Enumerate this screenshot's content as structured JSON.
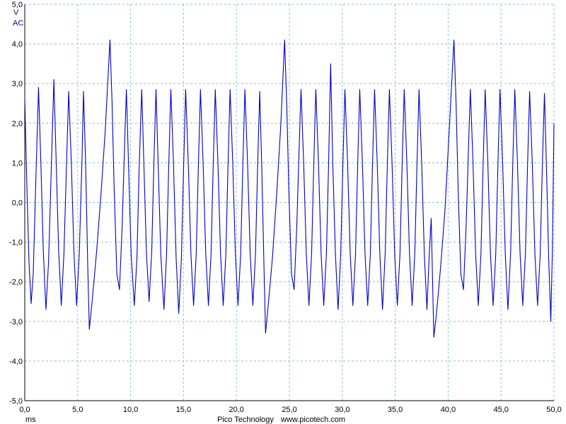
{
  "chart_data": {
    "type": "line",
    "xlabel": "ms",
    "ylabel_unit": "V",
    "ylabel_coupling": "AC",
    "xlim": [
      0,
      50
    ],
    "ylim": [
      -5,
      5
    ],
    "x_ticks": [
      "0,0",
      "5,0",
      "10,0",
      "15,0",
      "20,0",
      "25,0",
      "30,0",
      "35,0",
      "40,0",
      "45,0",
      "50,0"
    ],
    "y_ticks": [
      "5,0",
      "4,0",
      "3,0",
      "2,0",
      "1,0",
      "0,0",
      "-1,0",
      "-2,0",
      "-3,0",
      "-4,0",
      "-5,0"
    ],
    "grid": true,
    "series": [
      {
        "color": "#0000c8",
        "points": [
          [
            0.0,
            2.6
          ],
          [
            0.2,
            0.4
          ],
          [
            0.4,
            -1.5
          ],
          [
            0.6,
            -2.55
          ],
          [
            0.8,
            -1.8
          ],
          [
            1.05,
            0.6
          ],
          [
            1.3,
            2.9
          ],
          [
            1.5,
            1.2
          ],
          [
            1.75,
            -1.2
          ],
          [
            2.0,
            -2.7
          ],
          [
            2.25,
            -1.5
          ],
          [
            2.5,
            0.8
          ],
          [
            2.75,
            3.1
          ],
          [
            2.95,
            1.2
          ],
          [
            3.2,
            -1.2
          ],
          [
            3.45,
            -2.6
          ],
          [
            3.7,
            -1.3
          ],
          [
            3.95,
            1.0
          ],
          [
            4.15,
            2.8
          ],
          [
            4.4,
            1.0
          ],
          [
            4.65,
            -1.3
          ],
          [
            4.9,
            -2.6
          ],
          [
            5.15,
            -1.3
          ],
          [
            5.4,
            1.0
          ],
          [
            5.55,
            2.8
          ],
          [
            5.75,
            1.0
          ],
          [
            5.95,
            -1.6
          ],
          [
            6.1,
            -3.2
          ],
          [
            6.4,
            -2.4
          ],
          [
            6.8,
            -1.2
          ],
          [
            7.2,
            0.2
          ],
          [
            7.6,
            1.8
          ],
          [
            8.05,
            4.1
          ],
          [
            8.25,
            2.5
          ],
          [
            8.45,
            0.3
          ],
          [
            8.7,
            -1.8
          ],
          [
            8.95,
            -2.2
          ],
          [
            9.2,
            -0.6
          ],
          [
            9.45,
            1.6
          ],
          [
            9.6,
            2.85
          ],
          [
            9.8,
            1.0
          ],
          [
            10.05,
            -1.3
          ],
          [
            10.35,
            -2.6
          ],
          [
            10.6,
            -1.4
          ],
          [
            10.8,
            0.8
          ],
          [
            11.05,
            2.85
          ],
          [
            11.25,
            1.0
          ],
          [
            11.5,
            -1.3
          ],
          [
            11.75,
            -2.5
          ],
          [
            12.0,
            -1.2
          ],
          [
            12.2,
            1.0
          ],
          [
            12.4,
            2.85
          ],
          [
            12.6,
            1.0
          ],
          [
            12.85,
            -1.3
          ],
          [
            13.15,
            -2.7
          ],
          [
            13.4,
            -1.3
          ],
          [
            13.6,
            0.9
          ],
          [
            13.8,
            2.85
          ],
          [
            14.05,
            1.0
          ],
          [
            14.3,
            -1.4
          ],
          [
            14.55,
            -2.8
          ],
          [
            14.8,
            -1.4
          ],
          [
            15.0,
            0.8
          ],
          [
            15.2,
            2.85
          ],
          [
            15.45,
            1.0
          ],
          [
            15.7,
            -1.3
          ],
          [
            15.95,
            -2.6
          ],
          [
            16.2,
            -1.3
          ],
          [
            16.4,
            0.9
          ],
          [
            16.6,
            2.85
          ],
          [
            16.85,
            1.0
          ],
          [
            17.1,
            -1.3
          ],
          [
            17.35,
            -2.6
          ],
          [
            17.6,
            -1.3
          ],
          [
            17.8,
            0.9
          ],
          [
            18.0,
            2.85
          ],
          [
            18.25,
            1.0
          ],
          [
            18.5,
            -1.3
          ],
          [
            18.75,
            -2.6
          ],
          [
            19.0,
            -1.3
          ],
          [
            19.2,
            0.9
          ],
          [
            19.4,
            2.85
          ],
          [
            19.65,
            1.0
          ],
          [
            19.9,
            -1.3
          ],
          [
            20.15,
            -2.6
          ],
          [
            20.4,
            -1.3
          ],
          [
            20.6,
            0.9
          ],
          [
            20.8,
            2.85
          ],
          [
            21.05,
            1.0
          ],
          [
            21.3,
            -1.3
          ],
          [
            21.55,
            -2.6
          ],
          [
            21.8,
            -1.3
          ],
          [
            22.0,
            0.9
          ],
          [
            22.2,
            2.8
          ],
          [
            22.4,
            0.8
          ],
          [
            22.6,
            -1.6
          ],
          [
            22.75,
            -3.3
          ],
          [
            23.0,
            -2.6
          ],
          [
            23.4,
            -1.4
          ],
          [
            23.8,
            0.2
          ],
          [
            24.2,
            2.0
          ],
          [
            24.55,
            4.1
          ],
          [
            24.75,
            2.5
          ],
          [
            24.95,
            0.3
          ],
          [
            25.2,
            -1.8
          ],
          [
            25.45,
            -2.2
          ],
          [
            25.7,
            -0.6
          ],
          [
            25.95,
            1.6
          ],
          [
            26.1,
            2.85
          ],
          [
            26.35,
            1.0
          ],
          [
            26.6,
            -1.3
          ],
          [
            26.85,
            -2.6
          ],
          [
            27.1,
            -1.3
          ],
          [
            27.3,
            0.9
          ],
          [
            27.5,
            2.85
          ],
          [
            27.75,
            1.0
          ],
          [
            28.0,
            -1.3
          ],
          [
            28.25,
            -2.6
          ],
          [
            28.5,
            -1.3
          ],
          [
            28.7,
            0.9
          ],
          [
            28.9,
            3.5
          ],
          [
            29.1,
            1.0
          ],
          [
            29.35,
            -1.3
          ],
          [
            29.6,
            -2.7
          ],
          [
            29.85,
            -1.3
          ],
          [
            30.05,
            0.9
          ],
          [
            30.25,
            2.85
          ],
          [
            30.5,
            1.0
          ],
          [
            30.75,
            -1.3
          ],
          [
            31.0,
            -2.6
          ],
          [
            31.25,
            -1.3
          ],
          [
            31.45,
            0.9
          ],
          [
            31.65,
            2.85
          ],
          [
            31.9,
            1.0
          ],
          [
            32.15,
            -1.3
          ],
          [
            32.4,
            -2.6
          ],
          [
            32.65,
            -1.3
          ],
          [
            32.85,
            0.9
          ],
          [
            33.05,
            2.85
          ],
          [
            33.3,
            1.0
          ],
          [
            33.55,
            -1.3
          ],
          [
            33.8,
            -2.7
          ],
          [
            34.05,
            -1.3
          ],
          [
            34.25,
            0.9
          ],
          [
            34.45,
            2.85
          ],
          [
            34.7,
            1.0
          ],
          [
            34.95,
            -1.3
          ],
          [
            35.2,
            -2.6
          ],
          [
            35.45,
            -1.3
          ],
          [
            35.65,
            0.9
          ],
          [
            35.85,
            2.85
          ],
          [
            36.1,
            1.0
          ],
          [
            36.35,
            -1.3
          ],
          [
            36.6,
            -2.6
          ],
          [
            36.85,
            -1.3
          ],
          [
            37.05,
            0.9
          ],
          [
            37.25,
            2.85
          ],
          [
            37.5,
            1.0
          ],
          [
            37.75,
            -1.3
          ],
          [
            38.0,
            -2.7
          ],
          [
            38.2,
            -1.4
          ],
          [
            38.4,
            -0.4
          ],
          [
            38.65,
            -3.4
          ],
          [
            38.9,
            -2.8
          ],
          [
            39.3,
            -1.6
          ],
          [
            39.7,
            -0.2
          ],
          [
            40.1,
            1.8
          ],
          [
            40.55,
            4.1
          ],
          [
            40.75,
            2.5
          ],
          [
            40.95,
            0.3
          ],
          [
            41.2,
            -1.8
          ],
          [
            41.45,
            -2.2
          ],
          [
            41.7,
            -0.6
          ],
          [
            41.95,
            1.6
          ],
          [
            42.1,
            2.85
          ],
          [
            42.35,
            1.0
          ],
          [
            42.6,
            -1.3
          ],
          [
            42.85,
            -2.6
          ],
          [
            43.1,
            -1.3
          ],
          [
            43.3,
            0.9
          ],
          [
            43.5,
            2.85
          ],
          [
            43.75,
            1.0
          ],
          [
            44.0,
            -1.3
          ],
          [
            44.25,
            -2.6
          ],
          [
            44.5,
            -1.3
          ],
          [
            44.7,
            0.9
          ],
          [
            44.9,
            2.85
          ],
          [
            45.15,
            1.0
          ],
          [
            45.4,
            -1.3
          ],
          [
            45.65,
            -2.7
          ],
          [
            45.9,
            -1.3
          ],
          [
            46.1,
            0.9
          ],
          [
            46.3,
            2.85
          ],
          [
            46.55,
            1.0
          ],
          [
            46.8,
            -1.3
          ],
          [
            47.05,
            -2.6
          ],
          [
            47.3,
            -1.3
          ],
          [
            47.5,
            0.9
          ],
          [
            47.7,
            2.8
          ],
          [
            47.95,
            1.0
          ],
          [
            48.2,
            -1.3
          ],
          [
            48.45,
            -2.6
          ],
          [
            48.7,
            -1.3
          ],
          [
            48.9,
            0.9
          ],
          [
            49.1,
            2.75
          ],
          [
            49.3,
            0.8
          ],
          [
            49.5,
            -1.4
          ],
          [
            49.7,
            -3.0
          ],
          [
            49.85,
            -1.2
          ],
          [
            50.0,
            2.0
          ]
        ]
      }
    ]
  },
  "footer": {
    "brand": "Pico Technology",
    "url": "www.picotech.com"
  },
  "colors": {
    "trace": "#0000c8",
    "grid": "#87c3dc",
    "unit_label": "#0000b4"
  }
}
